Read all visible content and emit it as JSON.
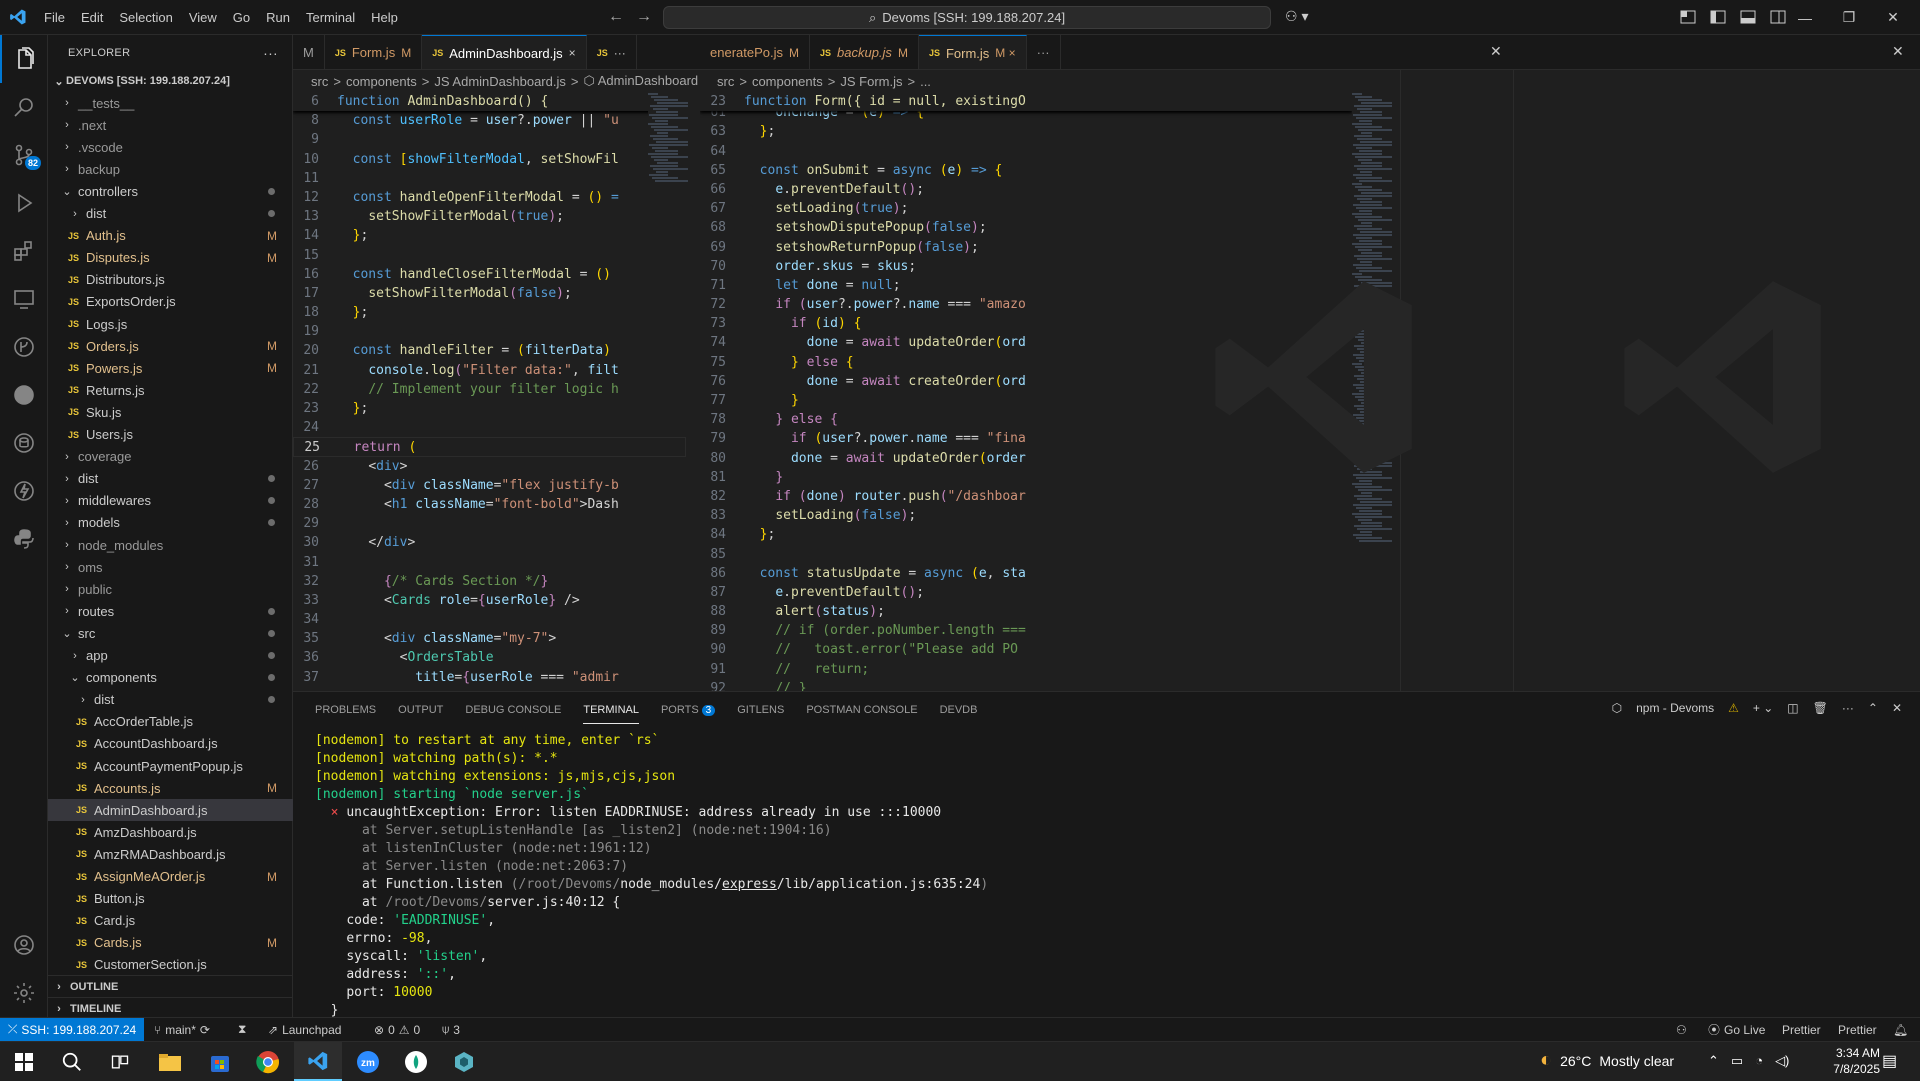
{
  "menu": [
    "File",
    "Edit",
    "Selection",
    "View",
    "Go",
    "Run",
    "Terminal",
    "Help"
  ],
  "command_center": "Devoms [SSH: 199.188.207.24]",
  "explorer": {
    "title": "EXPLORER",
    "root": "DEVOMS [SSH: 199.188.207.24]",
    "scm_badge": "82",
    "items": [
      {
        "label": "__tests__",
        "type": "folder",
        "indent": 0,
        "open": false,
        "status": ""
      },
      {
        "label": ".next",
        "type": "folder",
        "indent": 0,
        "open": false,
        "status": ""
      },
      {
        "label": ".vscode",
        "type": "folder",
        "indent": 0,
        "open": false,
        "status": ""
      },
      {
        "label": "backup",
        "type": "folder",
        "indent": 0,
        "open": false,
        "status": ""
      },
      {
        "label": "controllers",
        "type": "folder",
        "indent": 0,
        "open": true,
        "status": "dot"
      },
      {
        "label": "dist",
        "type": "folder",
        "indent": 1,
        "open": false,
        "status": "dot"
      },
      {
        "label": "Auth.js",
        "type": "file",
        "indent": 1,
        "status": "M"
      },
      {
        "label": "Disputes.js",
        "type": "file",
        "indent": 1,
        "status": "M"
      },
      {
        "label": "Distributors.js",
        "type": "file",
        "indent": 1,
        "status": ""
      },
      {
        "label": "ExportsOrder.js",
        "type": "file",
        "indent": 1,
        "status": ""
      },
      {
        "label": "Logs.js",
        "type": "file",
        "indent": 1,
        "status": ""
      },
      {
        "label": "Orders.js",
        "type": "file",
        "indent": 1,
        "status": "M"
      },
      {
        "label": "Powers.js",
        "type": "file",
        "indent": 1,
        "status": "M"
      },
      {
        "label": "Returns.js",
        "type": "file",
        "indent": 1,
        "status": ""
      },
      {
        "label": "Sku.js",
        "type": "file",
        "indent": 1,
        "status": ""
      },
      {
        "label": "Users.js",
        "type": "file",
        "indent": 1,
        "status": ""
      },
      {
        "label": "coverage",
        "type": "folder",
        "indent": 0,
        "open": false,
        "status": ""
      },
      {
        "label": "dist",
        "type": "folder",
        "indent": 0,
        "open": false,
        "status": "dot"
      },
      {
        "label": "middlewares",
        "type": "folder",
        "indent": 0,
        "open": false,
        "status": "dot"
      },
      {
        "label": "models",
        "type": "folder",
        "indent": 0,
        "open": false,
        "status": "dot"
      },
      {
        "label": "node_modules",
        "type": "folder",
        "indent": 0,
        "open": false,
        "status": ""
      },
      {
        "label": "oms",
        "type": "folder",
        "indent": 0,
        "open": false,
        "status": ""
      },
      {
        "label": "public",
        "type": "folder",
        "indent": 0,
        "open": false,
        "status": ""
      },
      {
        "label": "routes",
        "type": "folder",
        "indent": 0,
        "open": false,
        "status": "dot"
      },
      {
        "label": "src",
        "type": "folder",
        "indent": 0,
        "open": true,
        "status": "dot"
      },
      {
        "label": "app",
        "type": "folder",
        "indent": 1,
        "open": false,
        "status": "dot"
      },
      {
        "label": "components",
        "type": "folder",
        "indent": 1,
        "open": true,
        "status": "dot"
      },
      {
        "label": "dist",
        "type": "folder",
        "indent": 2,
        "open": false,
        "status": "dot"
      },
      {
        "label": "AccOrderTable.js",
        "type": "file",
        "indent": 2,
        "status": ""
      },
      {
        "label": "AccountDashboard.js",
        "type": "file",
        "indent": 2,
        "status": ""
      },
      {
        "label": "AccountPaymentPopup.js",
        "type": "file",
        "indent": 2,
        "status": ""
      },
      {
        "label": "Accounts.js",
        "type": "file",
        "indent": 2,
        "status": "M"
      },
      {
        "label": "AdminDashboard.js",
        "type": "file",
        "indent": 2,
        "status": "",
        "selected": true
      },
      {
        "label": "AmzDashboard.js",
        "type": "file",
        "indent": 2,
        "status": ""
      },
      {
        "label": "AmzRMADashboard.js",
        "type": "file",
        "indent": 2,
        "status": ""
      },
      {
        "label": "AssignMeAOrder.js",
        "type": "file",
        "indent": 2,
        "status": "M"
      },
      {
        "label": "Button.js",
        "type": "file",
        "indent": 2,
        "status": ""
      },
      {
        "label": "Card.js",
        "type": "file",
        "indent": 2,
        "status": ""
      },
      {
        "label": "Cards.js",
        "type": "file",
        "indent": 2,
        "status": "M"
      },
      {
        "label": "CustomerSection.js",
        "type": "file",
        "indent": 2,
        "status": ""
      }
    ],
    "outline": "OUTLINE",
    "timeline": "TIMELINE"
  },
  "tabs_left": [
    {
      "label": "M",
      "icon": "",
      "mod": ""
    },
    {
      "label": "Form.js",
      "icon": "JS",
      "mod": "M"
    },
    {
      "label": "AdminDashboard.js",
      "icon": "JS",
      "mod": "×",
      "active": true
    },
    {
      "label": "JS",
      "icon": "",
      "mod": "···"
    }
  ],
  "tabs_right": [
    {
      "label": "eneratePo.js",
      "icon": "",
      "mod": "M"
    },
    {
      "label": "backup.js",
      "icon": "JS",
      "mod": "M"
    },
    {
      "label": "Form.js",
      "icon": "JS",
      "mod": "M ×",
      "active": true
    },
    {
      "label": "···",
      "icon": "",
      "mod": ""
    }
  ],
  "breadcrumb_left": [
    "src",
    ">",
    "components",
    ">",
    "JS AdminDashboard.js",
    ">",
    "⬡ AdminDashboard"
  ],
  "breadcrumb_right": [
    "src",
    ">",
    "components",
    ">",
    "JS Form.js",
    ">",
    "..."
  ],
  "sticky_left": "function AdminDashboard() {",
  "sticky_left_ln": "6",
  "sticky_right": "function Form({ id = null, existingO",
  "sticky_right_ln": "23",
  "code_left": [
    {
      "ln": "8",
      "html": "  <span class='k'>const</span> <span class='cn'>userRole</span> <span class='o'>=</span> <span class='v'>user</span><span class='o'>?.</span><span class='v'>power</span> <span class='o'>||</span> <span class='s'>\"u</span>"
    },
    {
      "ln": "9",
      "html": ""
    },
    {
      "ln": "10",
      "html": "  <span class='k'>const</span> <span class='p'>[</span><span class='cn'>showFilterModal</span><span class='o'>,</span> <span class='f'>setShowFil</span>"
    },
    {
      "ln": "11",
      "html": ""
    },
    {
      "ln": "12",
      "html": "  <span class='k'>const</span> <span class='f'>handleOpenFilterModal</span> <span class='o'>=</span> <span class='p'>()</span> <span class='k'>=</span>"
    },
    {
      "ln": "13",
      "html": "    <span class='f'>setShowFilterModal</span><span class='pk'>(</span><span class='k'>true</span><span class='pk'>)</span><span class='o'>;</span>"
    },
    {
      "ln": "14",
      "html": "  <span class='p'>}</span><span class='o'>;</span>"
    },
    {
      "ln": "15",
      "html": ""
    },
    {
      "ln": "16",
      "html": "  <span class='k'>const</span> <span class='f'>handleCloseFilterModal</span> <span class='o'>=</span> <span class='p'>()</span>"
    },
    {
      "ln": "17",
      "html": "    <span class='f'>setShowFilterModal</span><span class='pk'>(</span><span class='k'>false</span><span class='pk'>)</span><span class='o'>;</span>"
    },
    {
      "ln": "18",
      "html": "  <span class='p'>}</span><span class='o'>;</span>"
    },
    {
      "ln": "19",
      "html": ""
    },
    {
      "ln": "20",
      "html": "  <span class='k'>const</span> <span class='f'>handleFilter</span> <span class='o'>=</span> <span class='p'>(</span><span class='v'>filterData</span><span class='p'>)</span>"
    },
    {
      "ln": "21",
      "html": "    <span class='v'>console</span><span class='o'>.</span><span class='f'>log</span><span class='pk'>(</span><span class='s'>\"Filter data:\"</span><span class='o'>,</span> <span class='v'>filt</span>"
    },
    {
      "ln": "22",
      "html": "    <span class='c'>// Implement your filter logic h</span>"
    },
    {
      "ln": "23",
      "html": "  <span class='p'>}</span><span class='o'>;</span>"
    },
    {
      "ln": "24",
      "html": ""
    },
    {
      "ln": "25",
      "html": "  <span class='pk'>return</span> <span class='p'>(</span>",
      "cur": true
    },
    {
      "ln": "26",
      "html": "    <span class='o'>&lt;</span><span class='k'>div</span><span class='o'>&gt;</span>"
    },
    {
      "ln": "27",
      "html": "      <span class='o'>&lt;</span><span class='k'>div</span> <span class='v'>className</span><span class='o'>=</span><span class='s'>\"flex justify-b</span>"
    },
    {
      "ln": "28",
      "html": "      <span class='o'>&lt;</span><span class='k'>h1</span> <span class='v'>className</span><span class='o'>=</span><span class='s'>\"font-bold\"</span><span class='o'>&gt;Dash</span>"
    },
    {
      "ln": "29",
      "html": ""
    },
    {
      "ln": "30",
      "html": "    <span class='o'>&lt;/</span><span class='k'>div</span><span class='o'>&gt;</span>"
    },
    {
      "ln": "31",
      "html": ""
    },
    {
      "ln": "32",
      "html": "      <span class='pk'>{</span><span class='c'>/* Cards Section */</span><span class='pk'>}</span>"
    },
    {
      "ln": "33",
      "html": "      <span class='o'>&lt;</span><span class='t'>Cards</span> <span class='v'>role</span><span class='o'>=</span><span class='pk'>{</span><span class='v'>userRole</span><span class='pk'>}</span> <span class='o'>/&gt;</span>"
    },
    {
      "ln": "34",
      "html": ""
    },
    {
      "ln": "35",
      "html": "      <span class='o'>&lt;</span><span class='k'>div</span> <span class='v'>className</span><span class='o'>=</span><span class='s'>\"my-7\"</span><span class='o'>&gt;</span>"
    },
    {
      "ln": "36",
      "html": "        <span class='o'>&lt;</span><span class='t'>OrdersTable</span>"
    },
    {
      "ln": "37",
      "html": "          <span class='v'>title</span><span class='o'>=</span><span class='pk'>{</span><span class='v'>userRole</span> <span class='o'>===</span> <span class='s'>\"admir</span>"
    }
  ],
  "code_right": [
    {
      "ln": "61",
      "html": "    <span class='v'>onChange</span> <span class='o'>=</span> <span class='p'>(</span><span class='v'>e</span><span class='p'>)</span> <span class='k'>=&gt;</span> <span class='p'>{</span>"
    },
    {
      "ln": "63",
      "html": "  <span class='p'>}</span><span class='o'>;</span>"
    },
    {
      "ln": "64",
      "html": ""
    },
    {
      "ln": "65",
      "html": "  <span class='k'>const</span> <span class='f'>onSubmit</span> <span class='o'>=</span> <span class='k'>async</span> <span class='p'>(</span><span class='v'>e</span><span class='p'>)</span> <span class='k'>=&gt;</span> <span class='p'>{</span>"
    },
    {
      "ln": "66",
      "html": "    <span class='v'>e</span><span class='o'>.</span><span class='f'>preventDefault</span><span class='pk'>()</span><span class='o'>;</span>"
    },
    {
      "ln": "67",
      "html": "    <span class='f'>setLoading</span><span class='pk'>(</span><span class='k'>true</span><span class='pk'>)</span><span class='o'>;</span>"
    },
    {
      "ln": "68",
      "html": "    <span class='f'>setshowDisputePopup</span><span class='pk'>(</span><span class='k'>false</span><span class='pk'>)</span><span class='o'>;</span>"
    },
    {
      "ln": "69",
      "html": "    <span class='f'>setshowReturnPopup</span><span class='pk'>(</span><span class='k'>false</span><span class='pk'>)</span><span class='o'>;</span>"
    },
    {
      "ln": "70",
      "html": "    <span class='v'>order</span><span class='o'>.</span><span class='v'>skus</span> <span class='o'>=</span> <span class='v'>skus</span><span class='o'>;</span>"
    },
    {
      "ln": "71",
      "html": "    <span class='k'>let</span> <span class='v'>done</span> <span class='o'>=</span> <span class='k'>null</span><span class='o'>;</span>"
    },
    {
      "ln": "72",
      "html": "    <span class='pk'>if</span> <span class='pk'>(</span><span class='v'>user</span><span class='o'>?.</span><span class='v'>power</span><span class='o'>?.</span><span class='v'>name</span> <span class='o'>===</span> <span class='s'>\"amazo</span>"
    },
    {
      "ln": "73",
      "html": "      <span class='pk'>if</span> <span class='p'>(</span><span class='v'>id</span><span class='p'>)</span> <span class='p'>{</span>"
    },
    {
      "ln": "74",
      "html": "        <span class='v'>done</span> <span class='o'>=</span> <span class='pk'>await</span> <span class='f'>updateOrder</span><span class='p'>(</span><span class='v'>ord</span>"
    },
    {
      "ln": "75",
      "html": "      <span class='p'>}</span> <span class='pk'>else</span> <span class='p'>{</span>"
    },
    {
      "ln": "76",
      "html": "        <span class='v'>done</span> <span class='o'>=</span> <span class='pk'>await</span> <span class='f'>createOrder</span><span class='p'>(</span><span class='v'>ord</span>"
    },
    {
      "ln": "77",
      "html": "      <span class='p'>}</span>"
    },
    {
      "ln": "78",
      "html": "    <span class='pk'>}</span> <span class='pk'>else</span> <span class='pk'>{</span>"
    },
    {
      "ln": "79",
      "html": "      <span class='pk'>if</span> <span class='p'>(</span><span class='v'>user</span><span class='o'>?.</span><span class='v'>power</span><span class='o'>.</span><span class='v'>name</span> <span class='o'>===</span> <span class='s'>\"fina</span>"
    },
    {
      "ln": "80",
      "html": "      <span class='v'>done</span> <span class='o'>=</span> <span class='pk'>await</span> <span class='f'>updateOrder</span><span class='p'>(</span><span class='v'>order</span>"
    },
    {
      "ln": "81",
      "html": "    <span class='pk'>}</span>"
    },
    {
      "ln": "82",
      "html": "    <span class='pk'>if</span> <span class='pk'>(</span><span class='v'>done</span><span class='pk'>)</span> <span class='v'>router</span><span class='o'>.</span><span class='f'>push</span><span class='pk'>(</span><span class='s'>\"/dashboar</span>"
    },
    {
      "ln": "83",
      "html": "    <span class='f'>setLoading</span><span class='pk'>(</span><span class='k'>false</span><span class='pk'>)</span><span class='o'>;</span>"
    },
    {
      "ln": "84",
      "html": "  <span class='p'>}</span><span class='o'>;</span>"
    },
    {
      "ln": "85",
      "html": ""
    },
    {
      "ln": "86",
      "html": "  <span class='k'>const</span> <span class='f'>statusUpdate</span> <span class='o'>=</span> <span class='k'>async</span> <span class='p'>(</span><span class='v'>e</span><span class='o'>,</span> <span class='v'>sta</span>"
    },
    {
      "ln": "87",
      "html": "    <span class='v'>e</span><span class='o'>.</span><span class='f'>preventDefault</span><span class='pk'>()</span><span class='o'>;</span>"
    },
    {
      "ln": "88",
      "html": "    <span class='f'>alert</span><span class='pk'>(</span><span class='v'>status</span><span class='pk'>)</span><span class='o'>;</span>"
    },
    {
      "ln": "89",
      "html": "    <span class='c'>// if (order.poNumber.length ===</span>"
    },
    {
      "ln": "90",
      "html": "    <span class='c'>//   toast.error(\"Please add PO</span>"
    },
    {
      "ln": "91",
      "html": "    <span class='c'>//   return;</span>"
    },
    {
      "ln": "92",
      "html": "    <span class='c'>// }</span>"
    }
  ],
  "panel": {
    "tabs": [
      "PROBLEMS",
      "OUTPUT",
      "DEBUG CONSOLE",
      "TERMINAL",
      "PORTS",
      "GITLENS",
      "POSTMAN CONSOLE",
      "DEVDB"
    ],
    "active": "TERMINAL",
    "ports_badge": "3",
    "terminal_name": "npm - Devoms",
    "lines": [
      {
        "html": "<span class='y'>[nodemon] to restart at any time, enter `rs`</span>"
      },
      {
        "html": "<span class='y'>[nodemon] watching path(s): *.*</span>"
      },
      {
        "html": "<span class='y'>[nodemon] watching extensions: js,mjs,cjs,json</span>"
      },
      {
        "html": "<span class='g'>[nodemon] starting `node server.js`</span>"
      },
      {
        "html": "  <span class='r'>×</span> <span class='w'>uncaughtException: Error: listen EADDRINUSE: address already in use :::10000</span>"
      },
      {
        "html": "      <span class='d'>at Server.setupListenHandle [as _listen2] (node:net:1904:16)</span>"
      },
      {
        "html": "      <span class='d'>at listenInCluster (node:net:1961:12)</span>"
      },
      {
        "html": "      <span class='d'>at Server.listen (node:net:2063:7)</span>"
      },
      {
        "html": "      <span class='w'>at Function.listen</span> <span class='d'>(/root/Devoms/</span><span class='w'>node_modules/<u>express</u>/lib/application.js:635:24</span><span class='d'>)</span>"
      },
      {
        "html": "      <span class='w'>at</span> <span class='d'>/root/Devoms/</span><span class='w'>server.js:40:12 {</span>"
      },
      {
        "html": "    <span class='w'>code:</span> <span class='gs'>'EADDRINUSE'</span><span class='w'>,</span>"
      },
      {
        "html": "    <span class='w'>errno:</span> <span class='yl'>-98</span><span class='w'>,</span>"
      },
      {
        "html": "    <span class='w'>syscall:</span> <span class='gs'>'listen'</span><span class='w'>,</span>"
      },
      {
        "html": "    <span class='w'>address:</span> <span class='gs'>'::'</span><span class='w'>,</span>"
      },
      {
        "html": "    <span class='w'>port:</span> <span class='yl'>10000</span>"
      },
      {
        "html": "  <span class='w'>}</span>"
      }
    ]
  },
  "status": {
    "remote": "SSH: 199.188.207.24",
    "branch": "main*",
    "launchpad": "Launchpad",
    "errors": "0",
    "warnings": "0",
    "ports": "3",
    "golive": "Go Live",
    "prettier1": "Prettier",
    "prettier2": "Prettier"
  },
  "taskbar": {
    "weather": "26°C",
    "weather_desc": "Mostly clear",
    "time": "3:34 AM",
    "date": "7/8/2025"
  }
}
